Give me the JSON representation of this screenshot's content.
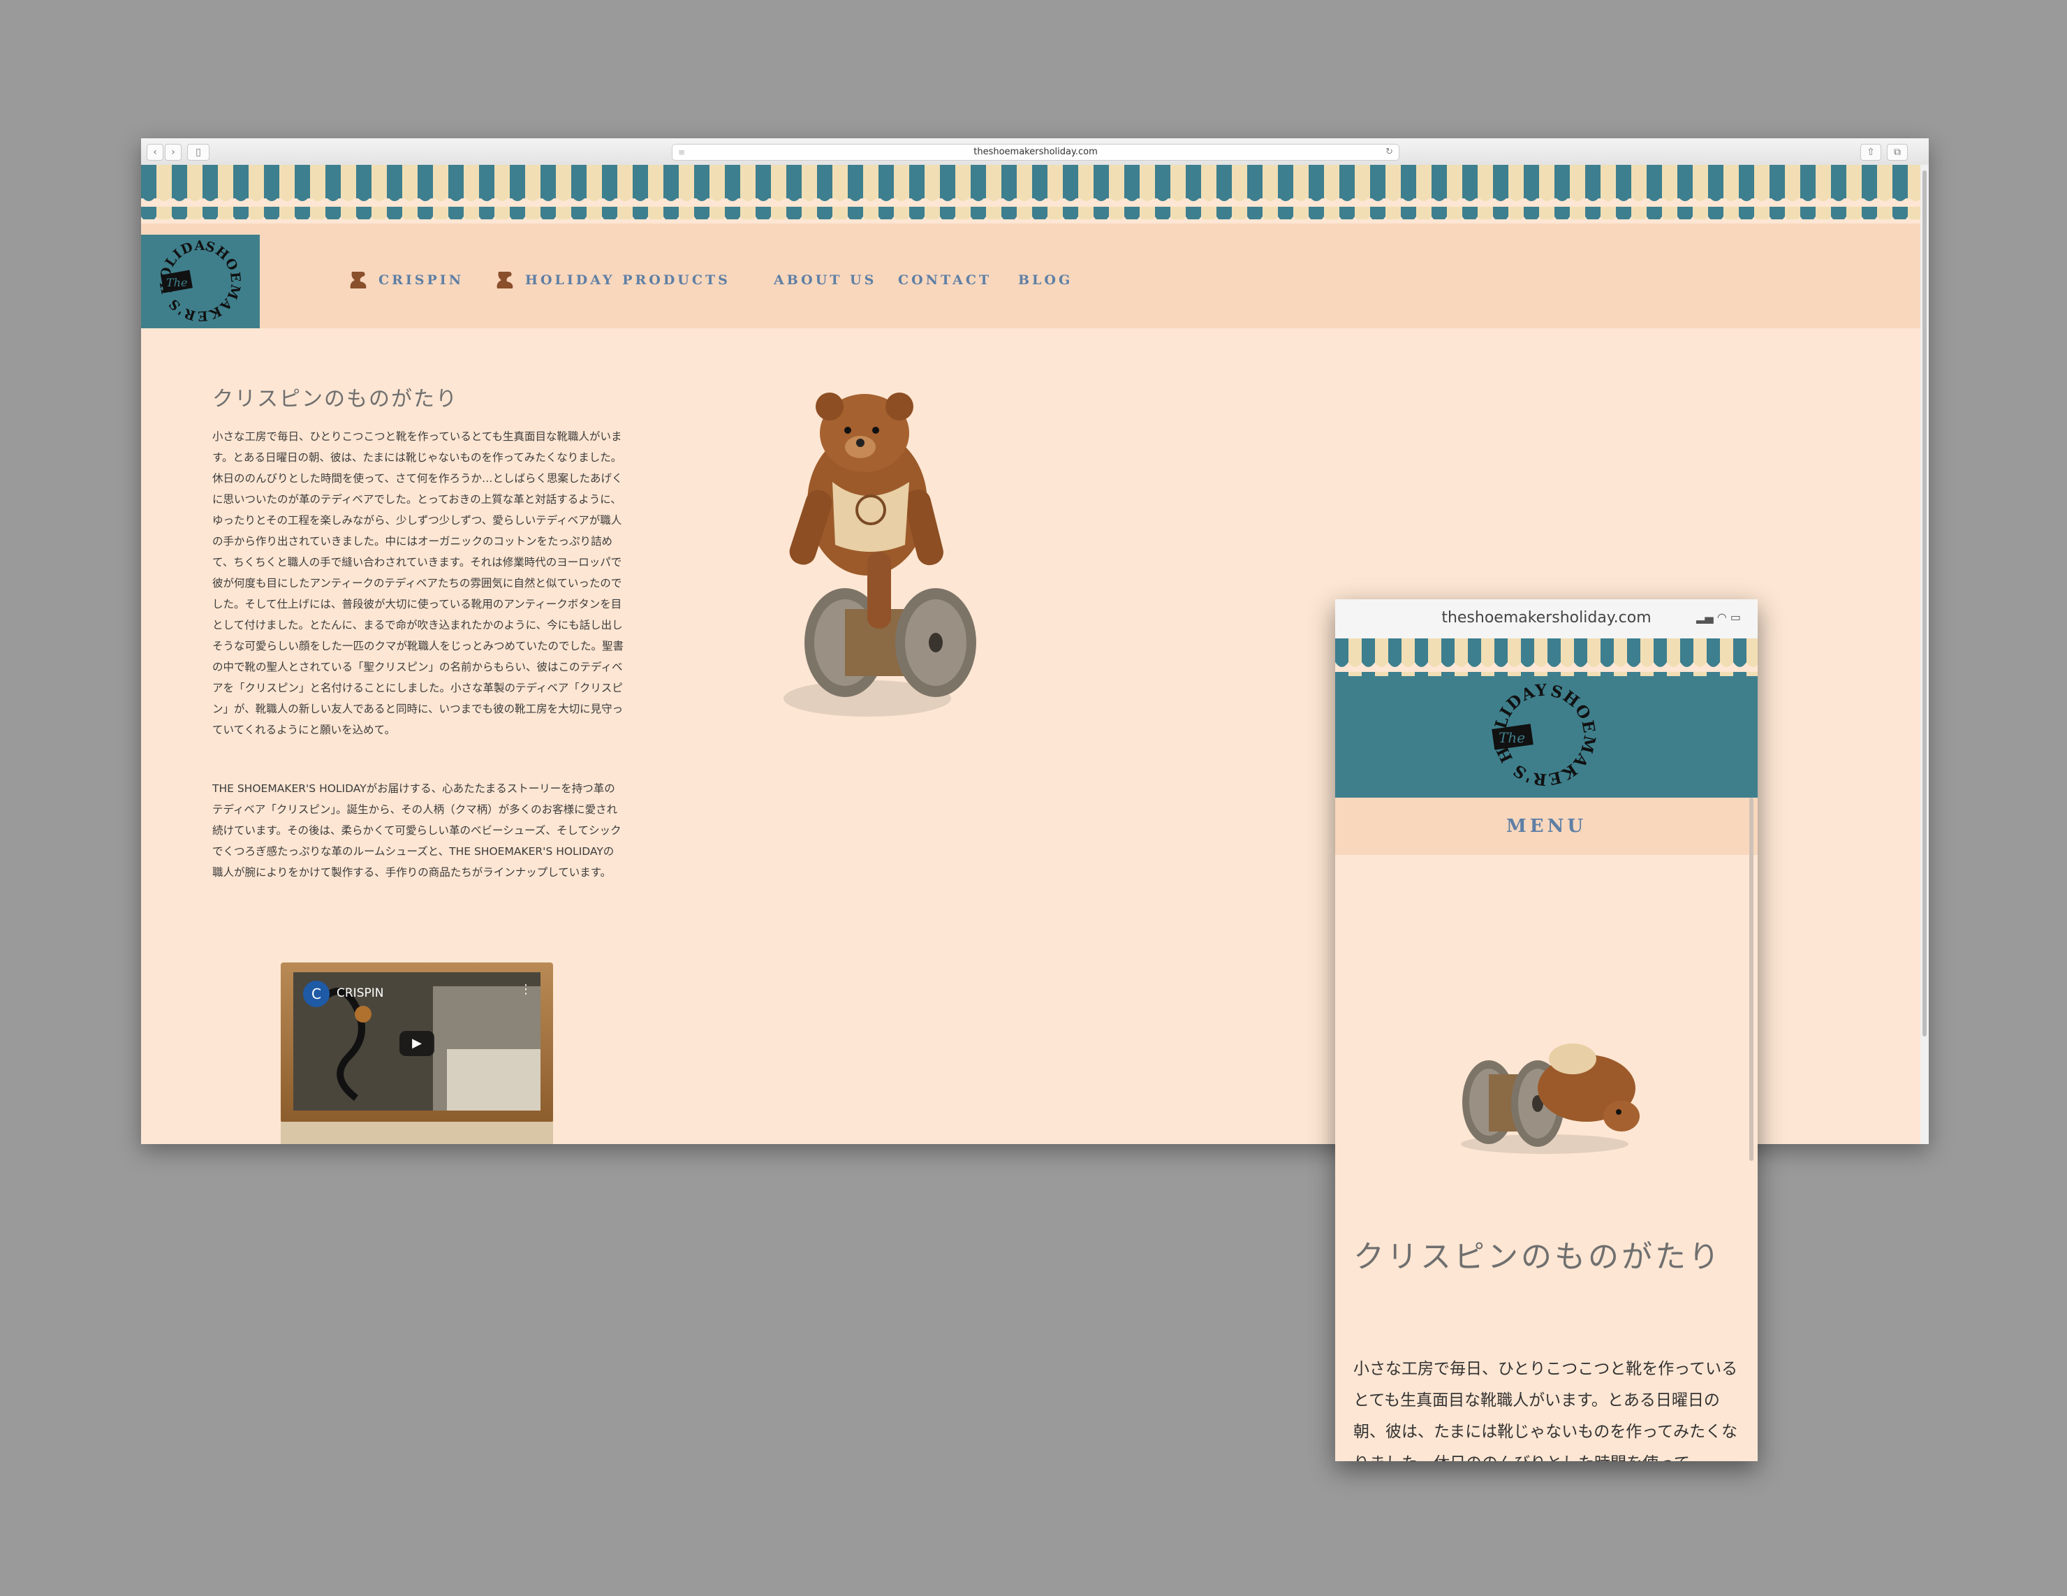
{
  "desktop": {
    "url": "theshoemakersholiday.com",
    "nav": [
      {
        "label": "CRISPIN",
        "icon": "shoe-icon"
      },
      {
        "label": "HOLIDAY PRODUCTS",
        "icon": "shoe-icon"
      },
      {
        "label": "ABOUT US"
      },
      {
        "label": "CONTACT"
      },
      {
        "label": "BLOG"
      }
    ],
    "logo": {
      "the": "The",
      "name": "SHOEMAKER'S HOLIDAY"
    },
    "title": "クリスピンのものがたり",
    "paragraph1": "小さな工房で毎日、ひとりこつこつと靴を作っているとても生真面目な靴職人がいます。とある日曜日の朝、彼は、たまには靴じゃないものを作ってみたくなりました。休日ののんびりとした時間を使って、さて何を作ろうか…としばらく思案したあげくに思いついたのが革のテディベアでした。とっておきの上質な革と対話するように、ゆったりとその工程を楽しみながら、少しずつ少しずつ、愛らしいテディベアが職人の手から作り出されていきました。中にはオーガニックのコットンをたっぷり詰めて、ちくちくと職人の手で縫い合わされていきます。それは修業時代のヨーロッパで彼が何度も目にしたアンティークのテディベアたちの雰囲気に自然と似ていったのでした。そして仕上げには、普段彼が大切に使っている靴用のアンティークボタンを目として付けました。とたんに、まるで命が吹き込まれたかのように、今にも話し出しそうな可愛らしい顔をした一匹のクマが靴職人をじっとみつめていたのでした。聖書の中で靴の聖人とされている「聖クリスピン」の名前からもらい、彼はこのテディベアを「クリスピン」と名付けることにしました。小さな革製のテディベア「クリスピン」が、靴職人の新しい友人であると同時に、いつまでも彼の靴工房を大切に見守っていてくれるようにと願いを込めて。",
    "paragraph2": "THE SHOEMAKER'S HOLIDAYがお届けする、心あたたまるストーリーを持つ革のテディベア「クリスピン」。誕生から、その人柄（クマ柄）が多くのお客様に愛され続けています。その後は、柔らかくて可愛らしい革のベビーシューズ、そしてシックでくつろぎ感たっぷりな革のルームシューズと、THE SHOEMAKER'S HOLIDAYの職人が腕によりをかけて製作する、手作りの商品たちがラインナップしています。",
    "video": {
      "channel_initial": "C",
      "title": "CRISPIN"
    }
  },
  "mobile": {
    "url": "theshoemakersholiday.com",
    "logo": {
      "the": "The",
      "name": "SHOEMAKER'S HOLIDAY"
    },
    "menu": "MENU",
    "title": "クリスピンのものがたり",
    "paragraph": "小さな工房で毎日、ひとりこつこつと靴を作っているとても生真面目な靴職人がいます。とある日曜日の朝、彼は、たまには靴じゃないものを作ってみたくなりました。休日ののんびりとした時間を使って、"
  },
  "colors": {
    "awning_teal": "#3d7f8e",
    "awning_cream": "#f1deb4",
    "header_peach": "#f8d7bd",
    "background": "#fde6d3",
    "nav_text": "#5e7fa5",
    "logo_teal": "#3f7f8c"
  }
}
